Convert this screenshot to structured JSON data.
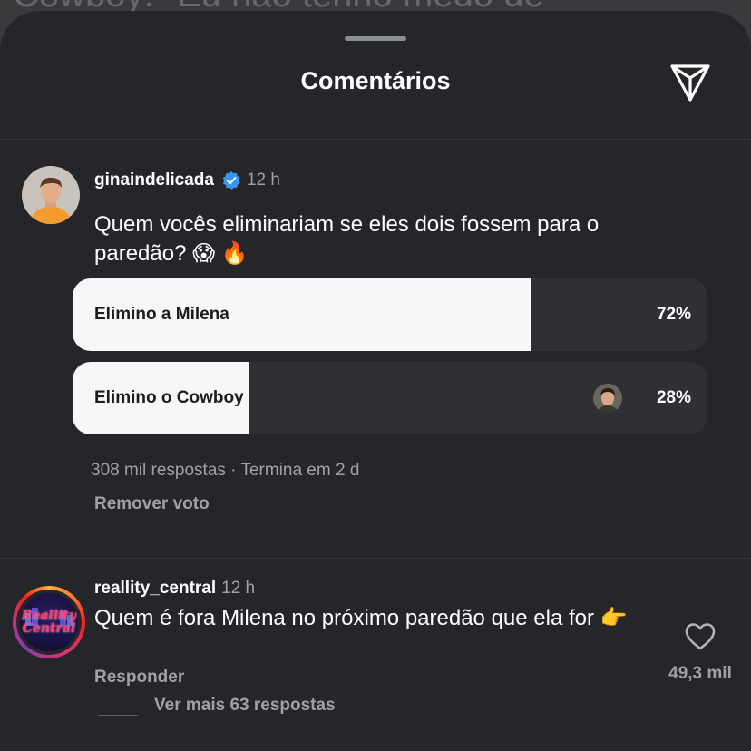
{
  "background_text": "Cowboy: \"Eu não tenho medo de",
  "sheet": {
    "title": "Comentários"
  },
  "post": {
    "username": "ginaindelicada",
    "time": "12 h",
    "text": "Quem vocês eliminariam se eles dois fossem para o paredão? 😱 🔥",
    "poll": {
      "options": [
        {
          "label": "Elimino a Milena",
          "percent_text": "72%",
          "percent": 72
        },
        {
          "label": "Elimino o Cowboy",
          "percent_text": "28%",
          "percent": 28
        }
      ],
      "summary": "308 mil respostas · Termina em 2 d",
      "remove_vote": "Remover voto"
    }
  },
  "comment": {
    "username": "reallity_central",
    "time": "12 h",
    "text": "Quem é fora Milena no próximo paredão que ela for 👉",
    "avatar_logo": "Reallity Central",
    "like_count": "49,3 mil",
    "reply_label": "Responder",
    "view_replies": "Ver mais 63 respostas"
  },
  "icons": {
    "send": "send-icon",
    "verified": "verified-badge-icon",
    "heart": "heart-icon"
  },
  "colors": {
    "sheet_bg": "#24262a",
    "verified": "#3897f0",
    "poll_fill": "#f7f7f8"
  }
}
